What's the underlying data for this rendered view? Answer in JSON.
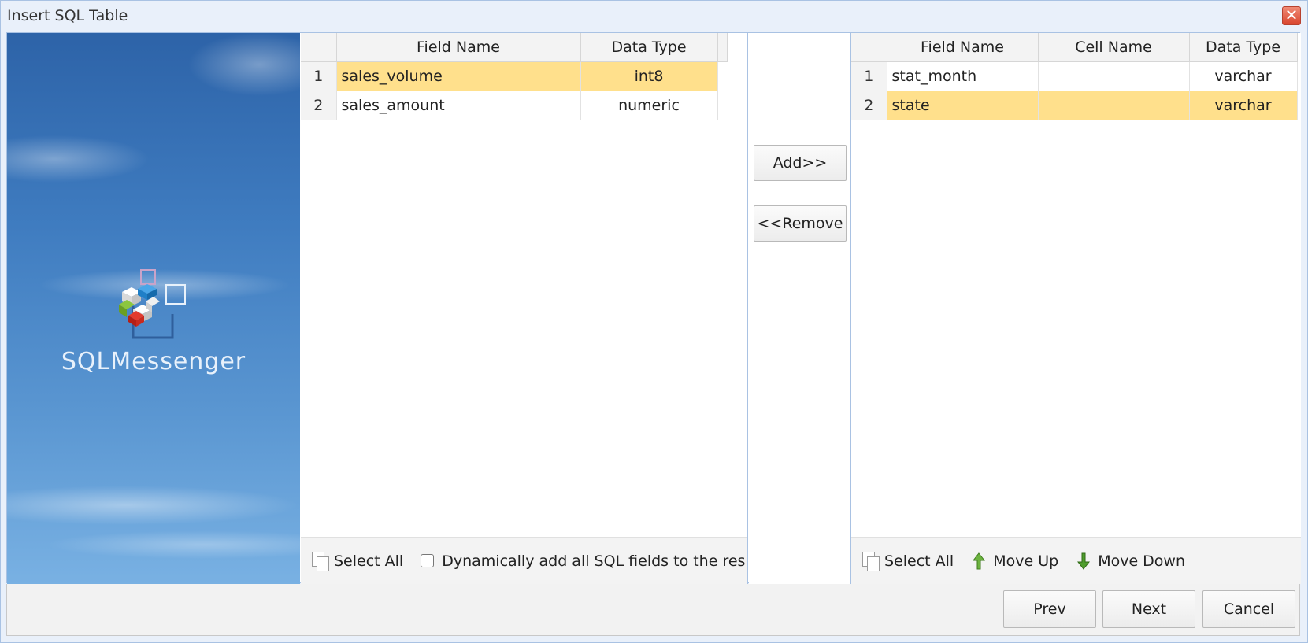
{
  "window": {
    "title": "Insert SQL Table",
    "close_glyph": "✕"
  },
  "banner": {
    "brand": "SQLMessenger",
    "logo_icon": "sqlmessenger-cube-logo-icon"
  },
  "left_table": {
    "columns": [
      "",
      "Field Name",
      "Data Type"
    ],
    "rows": [
      {
        "num": "1",
        "field": "sales_volume",
        "type": "int8"
      },
      {
        "num": "2",
        "field": "sales_amount",
        "type": "numeric"
      }
    ],
    "selected_row": 0
  },
  "left_footer": {
    "select_all": "Select All",
    "dynamic_checkbox": "Dynamically add all SQL fields to the res",
    "dynamic_checked": false
  },
  "middle": {
    "add": "Add>>",
    "remove": "<<Remove"
  },
  "right_table": {
    "columns": [
      "",
      "Field Name",
      "Cell Name",
      "Data Type"
    ],
    "rows": [
      {
        "num": "1",
        "field": "stat_month",
        "cell": "",
        "type": "varchar"
      },
      {
        "num": "2",
        "field": "state",
        "cell": "",
        "type": "varchar"
      }
    ],
    "selected_row": 1
  },
  "right_footer": {
    "select_all": "Select All",
    "move_up": "Move Up",
    "move_down": "Move Down"
  },
  "buttons": {
    "prev": "Prev",
    "next": "Next",
    "cancel": "Cancel"
  },
  "colors": {
    "selection": "#ffe08c",
    "border": "#a9c2e3",
    "move_up": "#6cb33f",
    "move_down": "#4f9d2d"
  }
}
